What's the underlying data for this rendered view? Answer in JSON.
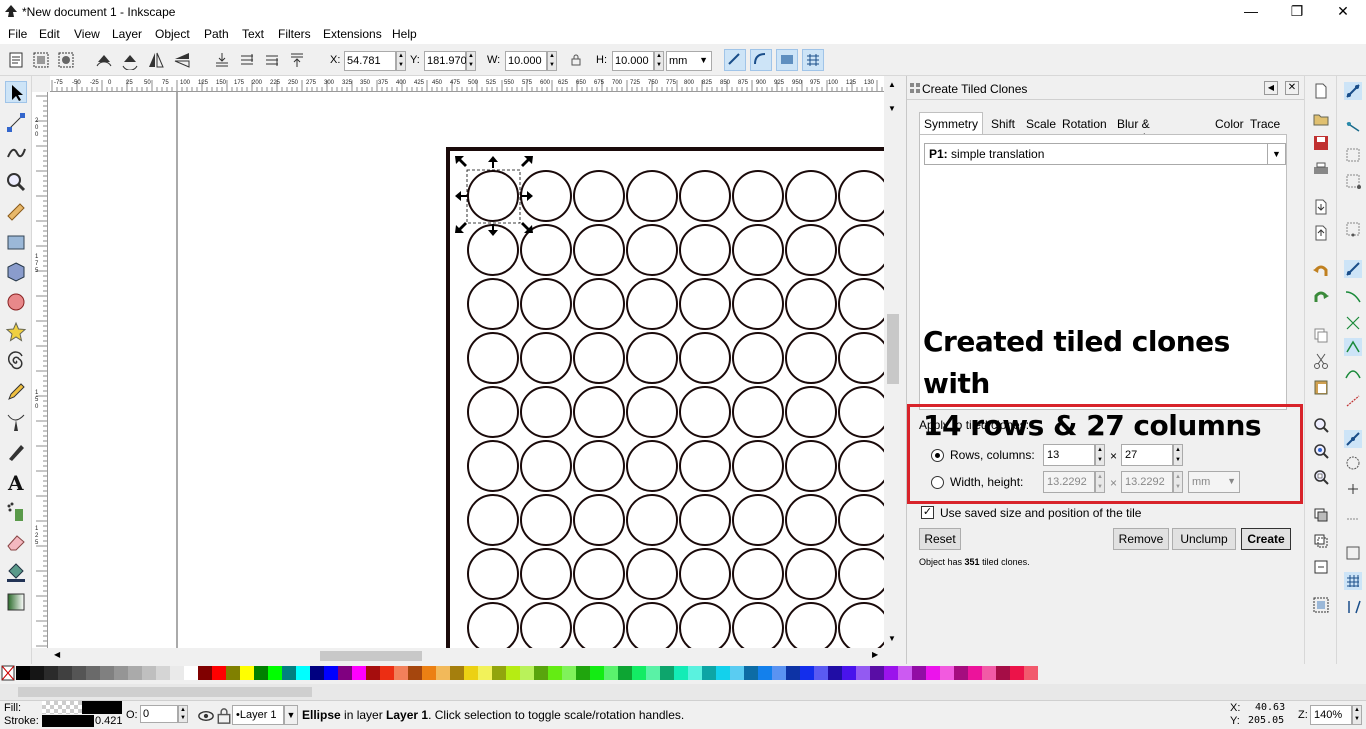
{
  "window": {
    "title": "*New document 1 - Inkscape",
    "minimize": "—",
    "maximize": "❐",
    "close": "✕"
  },
  "menu": [
    "File",
    "Edit",
    "View",
    "Layer",
    "Object",
    "Path",
    "Text",
    "Filters",
    "Extensions",
    "Help"
  ],
  "toolbar": {
    "x_label": "X:",
    "x_value": "54.781",
    "y_label": "Y:",
    "y_value": "181.970",
    "w_label": "W:",
    "w_value": "10.000",
    "h_label": "H:",
    "h_value": "10.000",
    "unit": "mm"
  },
  "rulers": {
    "h_ticks": [
      "-75",
      "-50",
      "-25",
      "0",
      "25",
      "50",
      "75",
      "100",
      "125",
      "150",
      "175",
      "200",
      "225",
      "250",
      "275",
      "300",
      "325",
      "350",
      "375",
      "400",
      "425",
      "450",
      "475",
      "500",
      "525",
      "550",
      "575",
      "600",
      "625",
      "650",
      "675",
      "700",
      "725",
      "750",
      "775",
      "800",
      "825",
      "850",
      "875",
      "900",
      "925",
      "950",
      "975",
      "100",
      "125",
      "130"
    ],
    "v_ticks": [
      "200",
      "175",
      "150",
      "125"
    ]
  },
  "dialog": {
    "title": "Create Tiled Clones",
    "tabs": [
      "Symmetry",
      "Shift",
      "Scale",
      "Rotation",
      "Blur & opacity",
      "Color",
      "Trace"
    ],
    "symmetry_code": "P1:",
    "symmetry_label": "simple translation",
    "overlay_line1": "Created tiled clones with",
    "overlay_line2": "14 rows & 27 columns",
    "apply_label": "Apply to tiled clones:",
    "rows_label": "Rows, columns:",
    "rows_value": "13",
    "times": "×",
    "cols_value": "27",
    "wh_label": "Width, height:",
    "width_value": "13.2292",
    "height_value": "13.2292",
    "wh_unit": "mm",
    "saved_label": "Use saved size and position of the tile",
    "reset": "Reset",
    "remove": "Remove",
    "unclump": "Unclump",
    "create": "Create",
    "status_prefix": "Object has ",
    "status_count": "351",
    "status_suffix": " tiled clones."
  },
  "statusbar": {
    "fill_label": "Fill:",
    "stroke_label": "Stroke:",
    "stroke_width": "0.421",
    "o_label": "O:",
    "opacity_value": "0",
    "layer": "•Layer 1",
    "msg_bold": "Ellipse",
    "msg_1": " in layer ",
    "msg_layer": "Layer 1",
    "msg_2": ". Click selection to toggle scale/rotation handles.",
    "x_label": "X:",
    "x_value": "40.63",
    "y_label": "Y:",
    "y_value": "205.05",
    "z_label": "Z:",
    "zoom": "140%"
  },
  "colors": {
    "accent_blue": "#cde4f7",
    "highlight_red": "#d8232a",
    "circle_stroke": "#1a0a0a"
  }
}
